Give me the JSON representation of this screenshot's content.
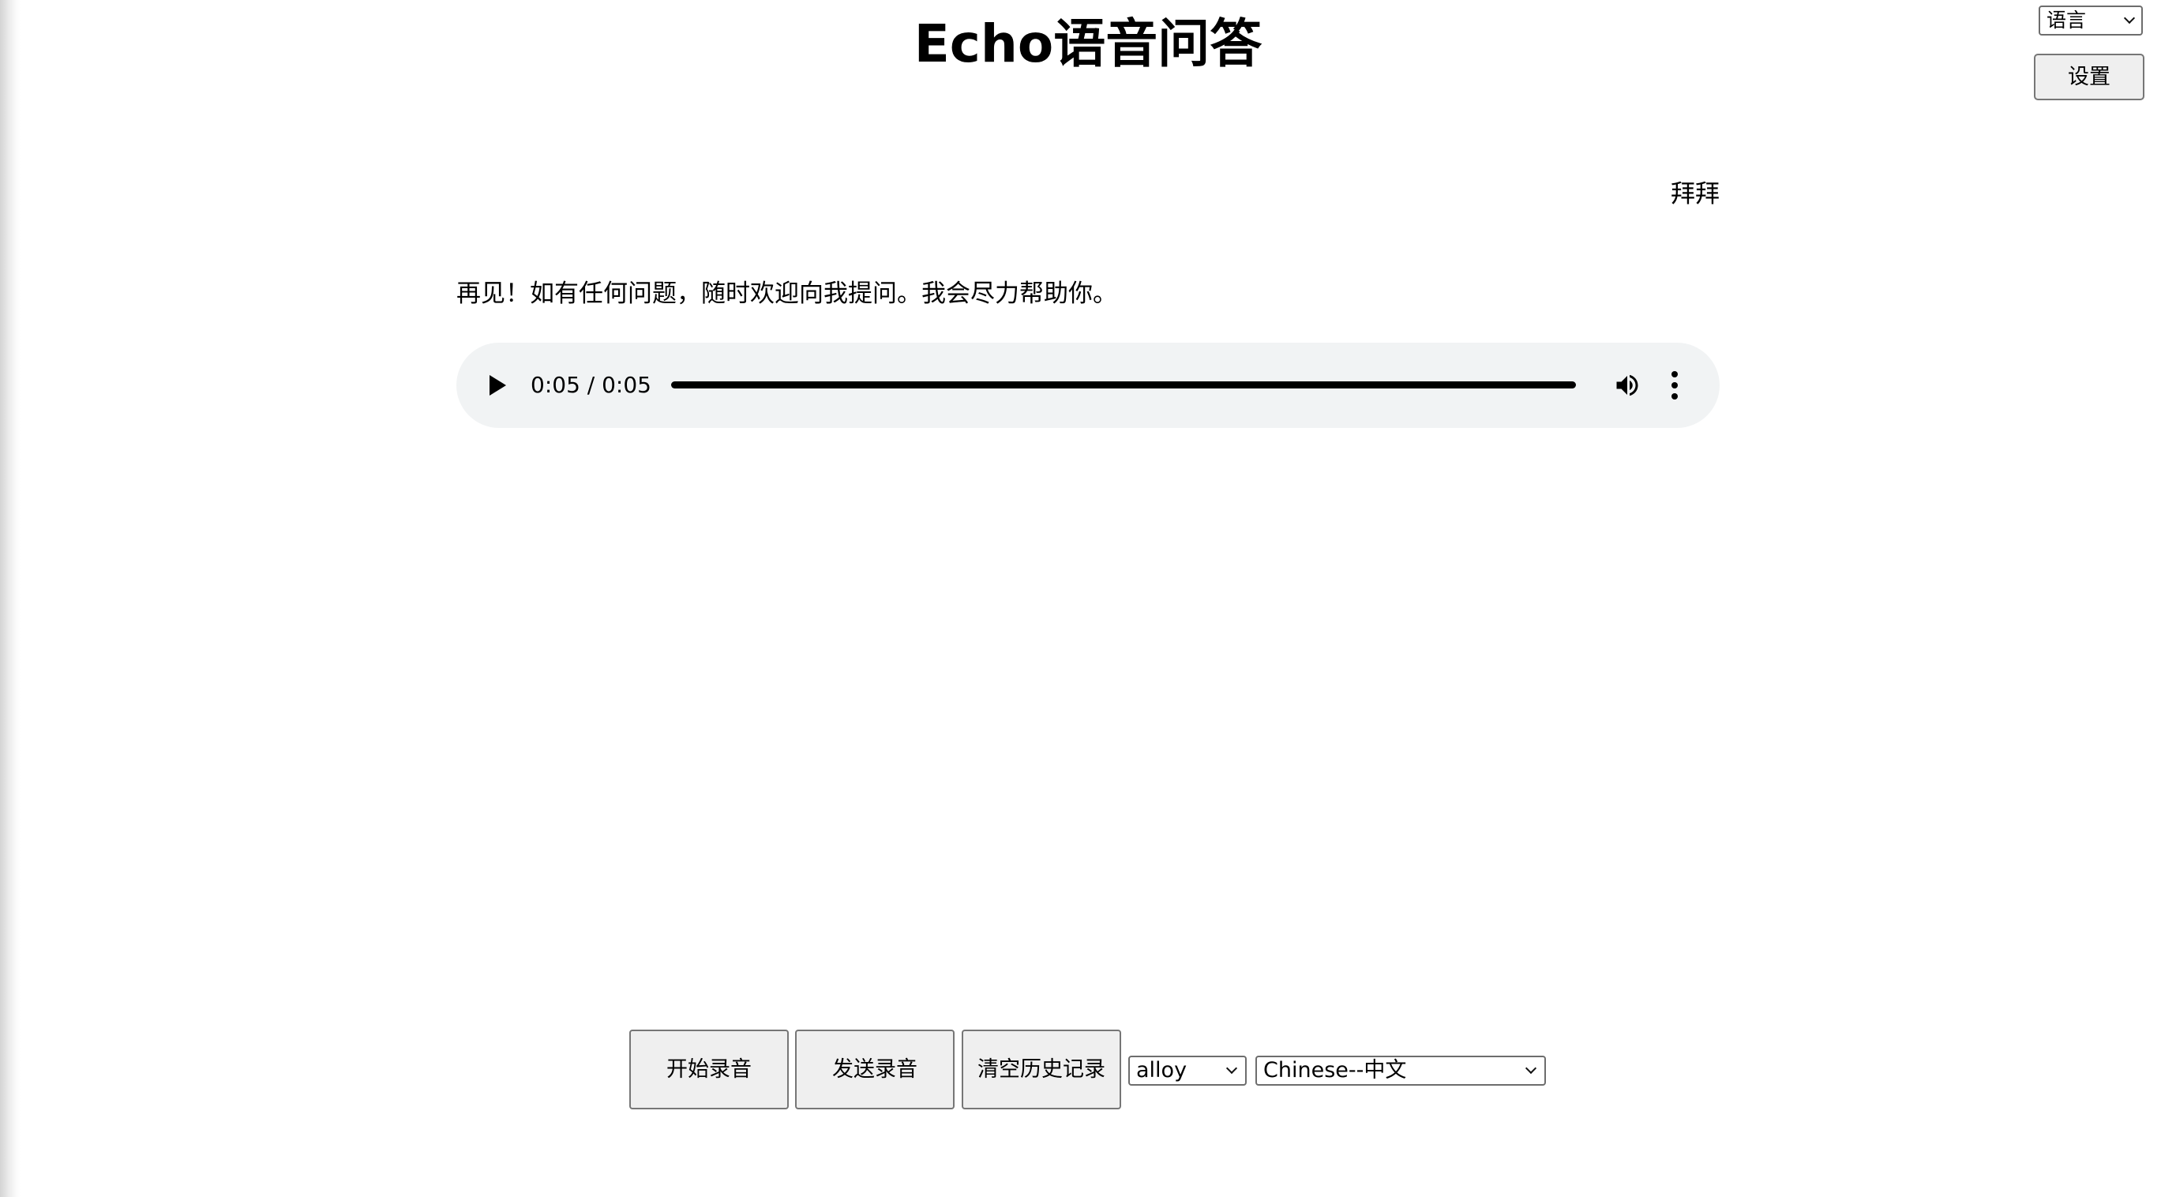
{
  "app": {
    "title": "Echo语音问答"
  },
  "header": {
    "language_select": {
      "selected": "语言"
    },
    "settings_label": "设置"
  },
  "conversation": {
    "user_message": "拜拜",
    "assistant_message": "再见！如有任何问题，随时欢迎向我提问。我会尽力帮助你。",
    "audio": {
      "time_display": "0:05 / 0:05",
      "progress": 1.0,
      "icons": [
        "play-icon",
        "volume-icon",
        "more-options-icon"
      ]
    }
  },
  "controls": {
    "start_recording_label": "开始录音",
    "send_recording_label": "发送录音",
    "clear_history_label": "清空历史记录",
    "voice_select": {
      "selected": "alloy"
    },
    "language_select": {
      "selected": "Chinese--中文"
    }
  }
}
